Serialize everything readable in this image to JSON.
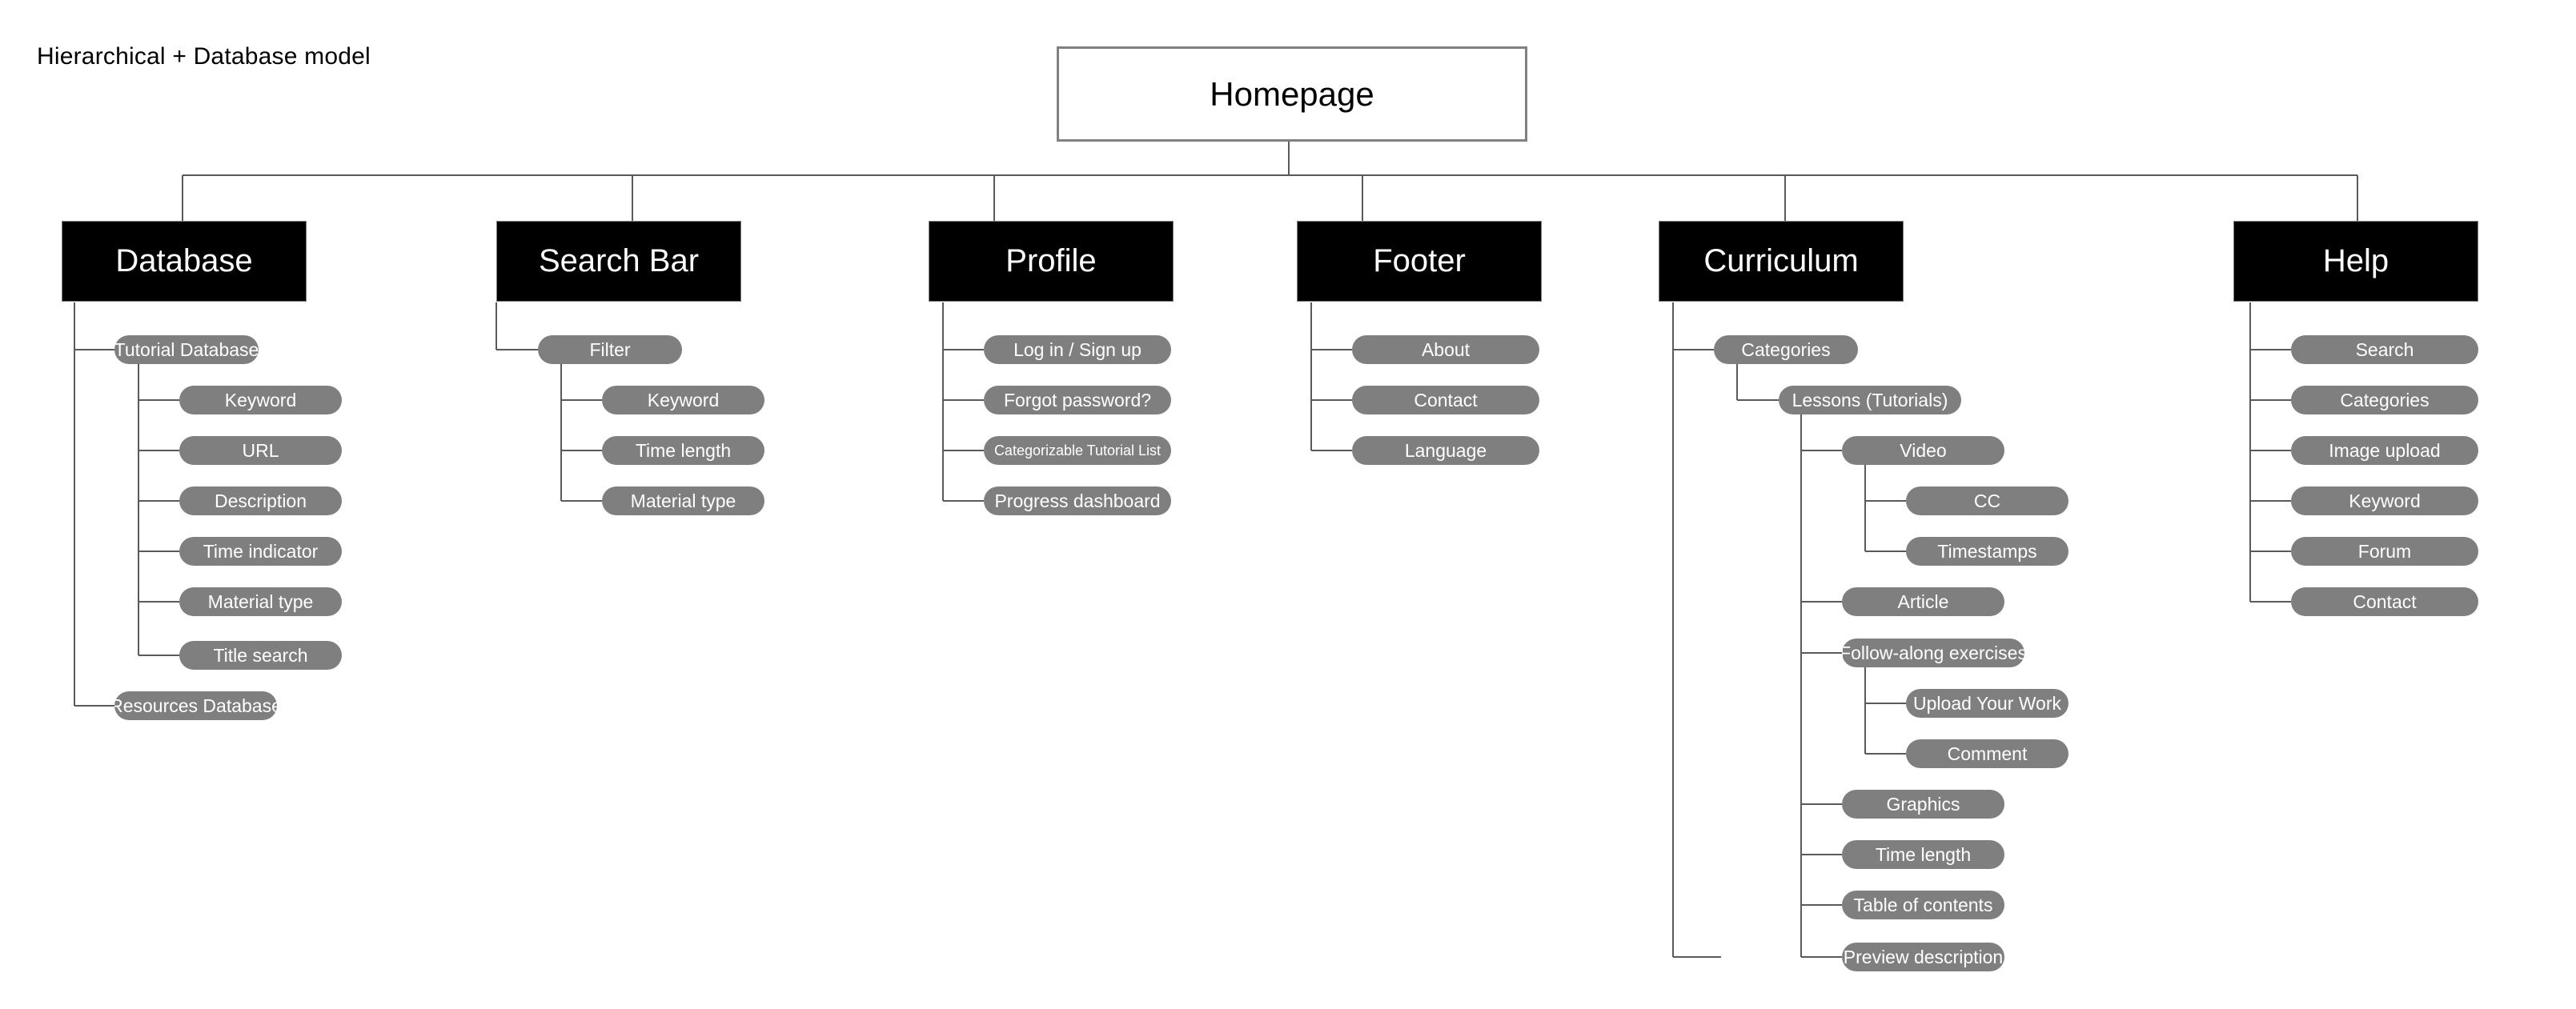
{
  "diagram": {
    "title": "Hierarchical + Database model",
    "type": "sitemap-tree",
    "colors": {
      "background": "#ffffff",
      "root_fill": "#ffffff",
      "root_border": "#808080",
      "section_fill": "#000000",
      "section_text": "#ffffff",
      "pill_fill": "#7f7f7f",
      "pill_text": "#ffffff",
      "connector": "#5a5a5a",
      "title_text": "#000000"
    }
  },
  "root": {
    "label": "Homepage"
  },
  "sections": [
    {
      "label": "Database",
      "children": [
        {
          "label": "Tutorial Database",
          "children": [
            {
              "label": "Keyword"
            },
            {
              "label": "URL"
            },
            {
              "label": "Description"
            },
            {
              "label": "Time indicator"
            },
            {
              "label": "Material type"
            },
            {
              "label": "Title search"
            }
          ]
        },
        {
          "label": "Resources Database"
        }
      ]
    },
    {
      "label": "Search Bar",
      "children": [
        {
          "label": "Filter",
          "children": [
            {
              "label": "Keyword"
            },
            {
              "label": "Time length"
            },
            {
              "label": "Material type"
            }
          ]
        }
      ]
    },
    {
      "label": "Profile",
      "children": [
        {
          "label": "Log in / Sign up"
        },
        {
          "label": "Forgot password?"
        },
        {
          "label": "Categorizable Tutorial List"
        },
        {
          "label": "Progress dashboard"
        }
      ]
    },
    {
      "label": "Footer",
      "children": [
        {
          "label": "About"
        },
        {
          "label": "Contact"
        },
        {
          "label": "Language"
        }
      ]
    },
    {
      "label": "Curriculum",
      "children": [
        {
          "label": "Categories",
          "children": [
            {
              "label": "Lessons (Tutorials)",
              "children": [
                {
                  "label": "Video",
                  "children": [
                    {
                      "label": "CC"
                    },
                    {
                      "label": "Timestamps"
                    }
                  ]
                },
                {
                  "label": "Article"
                },
                {
                  "label": "Follow-along exercises",
                  "children": [
                    {
                      "label": "Upload Your Work"
                    },
                    {
                      "label": "Comment"
                    }
                  ]
                },
                {
                  "label": "Graphics"
                },
                {
                  "label": "Time length"
                },
                {
                  "label": "Table of contents"
                },
                {
                  "label": "Preview description"
                }
              ]
            }
          ]
        }
      ]
    },
    {
      "label": "Help",
      "children": [
        {
          "label": "Search"
        },
        {
          "label": "Categories"
        },
        {
          "label": "Image upload"
        },
        {
          "label": "Keyword"
        },
        {
          "label": "Forum"
        },
        {
          "label": "Contact"
        }
      ]
    }
  ]
}
